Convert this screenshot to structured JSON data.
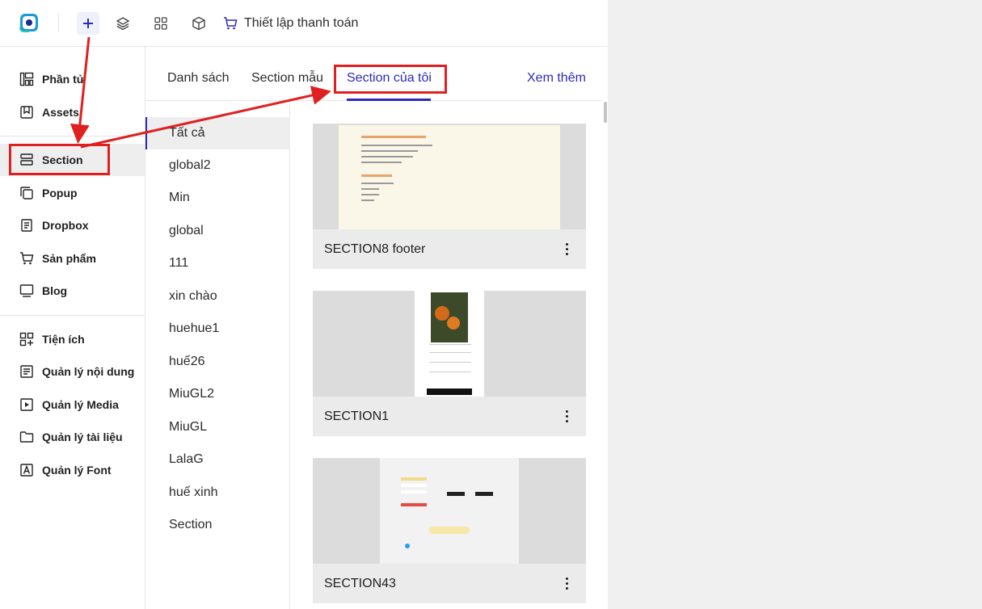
{
  "toolbar": {
    "checkout_label": "Thiết lập thanh toán"
  },
  "sidebar": {
    "items": [
      {
        "label": "Phần tử",
        "icon": "elements-icon"
      },
      {
        "label": "Assets",
        "icon": "assets-icon"
      },
      {
        "label": "Section",
        "icon": "section-icon",
        "active": true
      },
      {
        "label": "Popup",
        "icon": "popup-icon"
      },
      {
        "label": "Dropbox",
        "icon": "dropbox-icon"
      },
      {
        "label": "Sản phẩm",
        "icon": "cart-icon"
      },
      {
        "label": "Blog",
        "icon": "blog-icon"
      },
      {
        "label": "Tiện ích",
        "icon": "apps-icon"
      },
      {
        "label": "Quản lý nội dung",
        "icon": "content-icon"
      },
      {
        "label": "Quản lý Media",
        "icon": "media-icon"
      },
      {
        "label": "Quản lý tài liệu",
        "icon": "folder-icon"
      },
      {
        "label": "Quản lý Font",
        "icon": "font-icon"
      }
    ]
  },
  "tabs": {
    "list": "Danh sách",
    "templates": "Section mẫu",
    "mine": "Section của tôi",
    "more": "Xem thêm"
  },
  "categories": [
    "Tất cả",
    "global2",
    "Min",
    "global",
    "111",
    "xin chào",
    "huehue1",
    "huế26",
    "MiuGL2",
    "MiuGL",
    "LalaG",
    "huế xinh",
    "Section"
  ],
  "cards": [
    {
      "title": "SECTION8 footer"
    },
    {
      "title": "SECTION1"
    },
    {
      "title": "SECTION43"
    }
  ],
  "colors": {
    "accent": "#2d2ab8",
    "annotation": "#e02020"
  }
}
